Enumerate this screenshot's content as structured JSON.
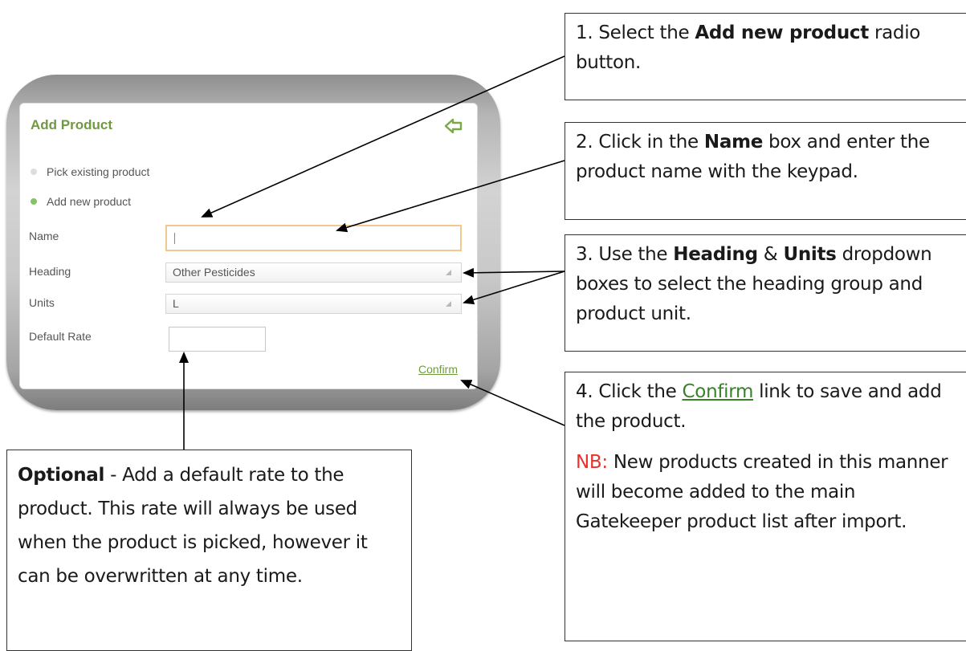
{
  "panel": {
    "title": "Add Product",
    "back_icon": "back-arrow-icon",
    "radio_pick_existing": "Pick existing product",
    "radio_add_new": "Add new product",
    "fields": {
      "name_label": "Name",
      "name_value": "",
      "heading_label": "Heading",
      "heading_value": "Other Pesticides",
      "units_label": "Units",
      "units_value": "L",
      "default_rate_label": "Default Rate",
      "default_rate_value": ""
    },
    "confirm_link": "Confirm"
  },
  "callouts": {
    "step1": {
      "pre": "1. Select the ",
      "bold": "Add new product",
      "post": " radio button."
    },
    "step2": {
      "pre": "2. Click in the ",
      "bold": "Name",
      "post": " box and enter the product name with the keypad."
    },
    "step3": {
      "pre": "3. Use the ",
      "bold1": "Heading",
      "mid": " & ",
      "bold2": "Units",
      "post": " dropdown boxes to select the heading group and product unit."
    },
    "step4": {
      "pre": "4. Click the ",
      "link": "Confirm",
      "post": " link to save and add the product."
    },
    "nb": {
      "label": "NB:",
      "text": " New products created in this manner will become added to the main Gatekeeper product list after import."
    },
    "optional": {
      "bold": "Optional",
      "text": " - Add a default rate to the product. This rate will always be used when the product is picked, however it can be overwritten at any time."
    }
  },
  "colors": {
    "accent_green": "#6f9a3f",
    "radio_selected": "#86c26a",
    "nb_red": "#e8322e",
    "input_focus_border": "#f0c890"
  }
}
